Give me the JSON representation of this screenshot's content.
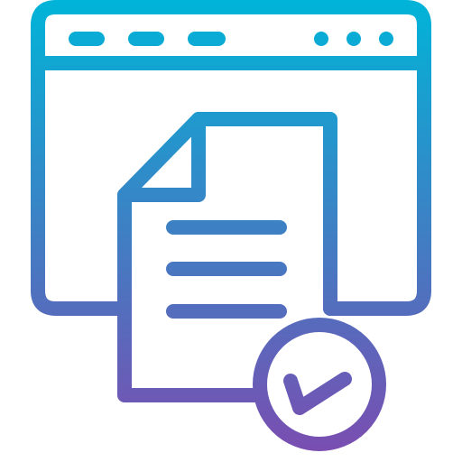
{
  "icon": {
    "name": "browser-document-check-icon",
    "parts": [
      "browser-window-icon",
      "document-icon",
      "check-badge-icon"
    ]
  },
  "colors": {
    "gradient_top": "#00b4d8",
    "gradient_bottom": "#7d4bb0",
    "background": "#ffffff"
  }
}
